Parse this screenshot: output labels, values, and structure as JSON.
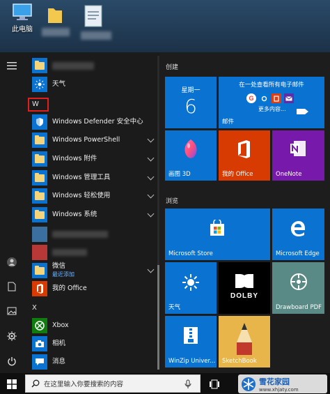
{
  "desktop": {
    "icons": [
      {
        "label": "此电脑"
      }
    ]
  },
  "applist": {
    "top_items": [
      {
        "label": "天气"
      }
    ],
    "section_w": "W",
    "w_items": [
      {
        "label": "Windows Defender 安全中心"
      },
      {
        "label": "Windows PowerShell"
      },
      {
        "label": "Windows 附件"
      },
      {
        "label": "Windows 管理工具"
      },
      {
        "label": "Windows 轻松使用"
      },
      {
        "label": "Windows 系统"
      }
    ],
    "wechat": {
      "label": "微信",
      "sub": "最近添加"
    },
    "myoffice": {
      "label": "我的 Office"
    },
    "section_x": "X",
    "x_items": [
      {
        "label": "Xbox"
      },
      {
        "label": "相机"
      },
      {
        "label": "消息"
      }
    ]
  },
  "tiles": {
    "group1": "创建",
    "calendar": {
      "weekday": "星期一",
      "day": "6"
    },
    "mail": {
      "title": "在一处查看所有电子邮件",
      "more": "更多内容...",
      "label": "邮件"
    },
    "paint3d": {
      "label": "画图 3D"
    },
    "myoffice": {
      "label": "我的 Office"
    },
    "onenote": {
      "label": "OneNote"
    },
    "group2": "浏览",
    "store": {
      "label": "Microsoft Store"
    },
    "edge": {
      "label": "Microsoft Edge"
    },
    "weather": {
      "label": "天气"
    },
    "dolby": {
      "label": "DOLBY"
    },
    "drawboard": {
      "label": "Drawboard PDF"
    },
    "winzip": {
      "label": "WinZip Univer..."
    },
    "sketchbook": {
      "label": "SketchBook"
    }
  },
  "taskbar": {
    "search_placeholder": "在这里输入你要搜索的内容",
    "watermark_title": "雪花家园",
    "watermark_url": "www.xhjaty.com"
  }
}
